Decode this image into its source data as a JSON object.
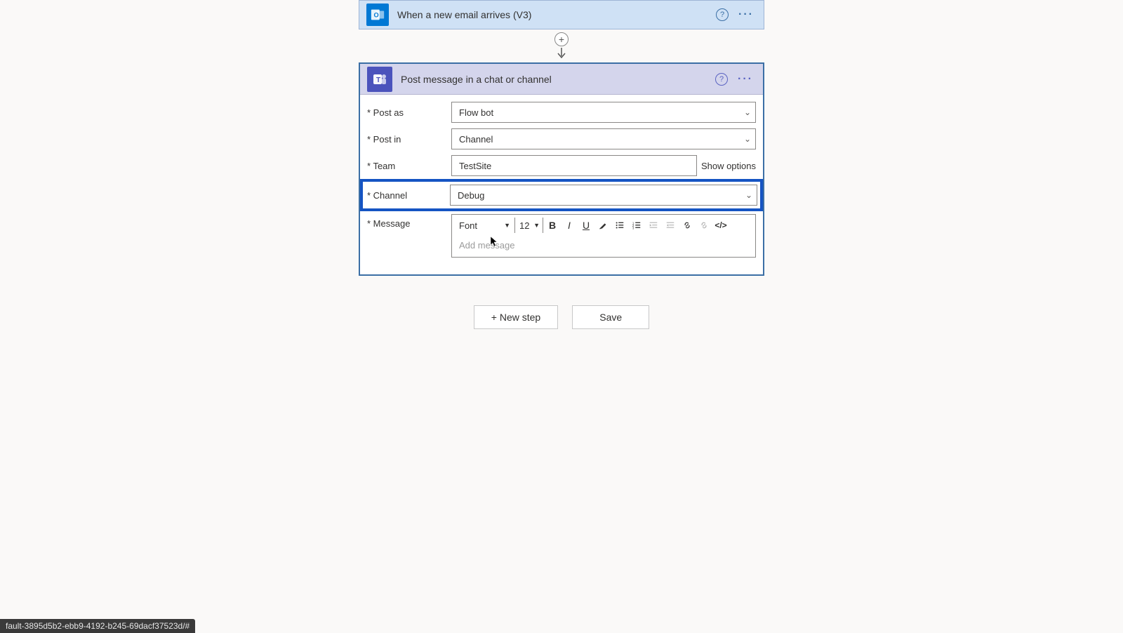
{
  "trigger": {
    "title": "When a new email arrives (V3)"
  },
  "action": {
    "title": "Post message in a chat or channel",
    "fields": {
      "post_as_label": "Post as",
      "post_as_value": "Flow bot",
      "post_in_label": "Post in",
      "post_in_value": "Channel",
      "team_label": "Team",
      "team_value": "TestSite",
      "team_show_options": "Show options",
      "channel_label": "Channel",
      "channel_value": "Debug",
      "message_label": "Message",
      "message_placeholder": "Add message"
    },
    "rte": {
      "font_label": "Font",
      "size_label": "12"
    }
  },
  "footer": {
    "new_step": "+ New step",
    "save": "Save"
  },
  "statusbar": "fault-3895d5b2-ebb9-4192-b245-69dacf37523d/#"
}
